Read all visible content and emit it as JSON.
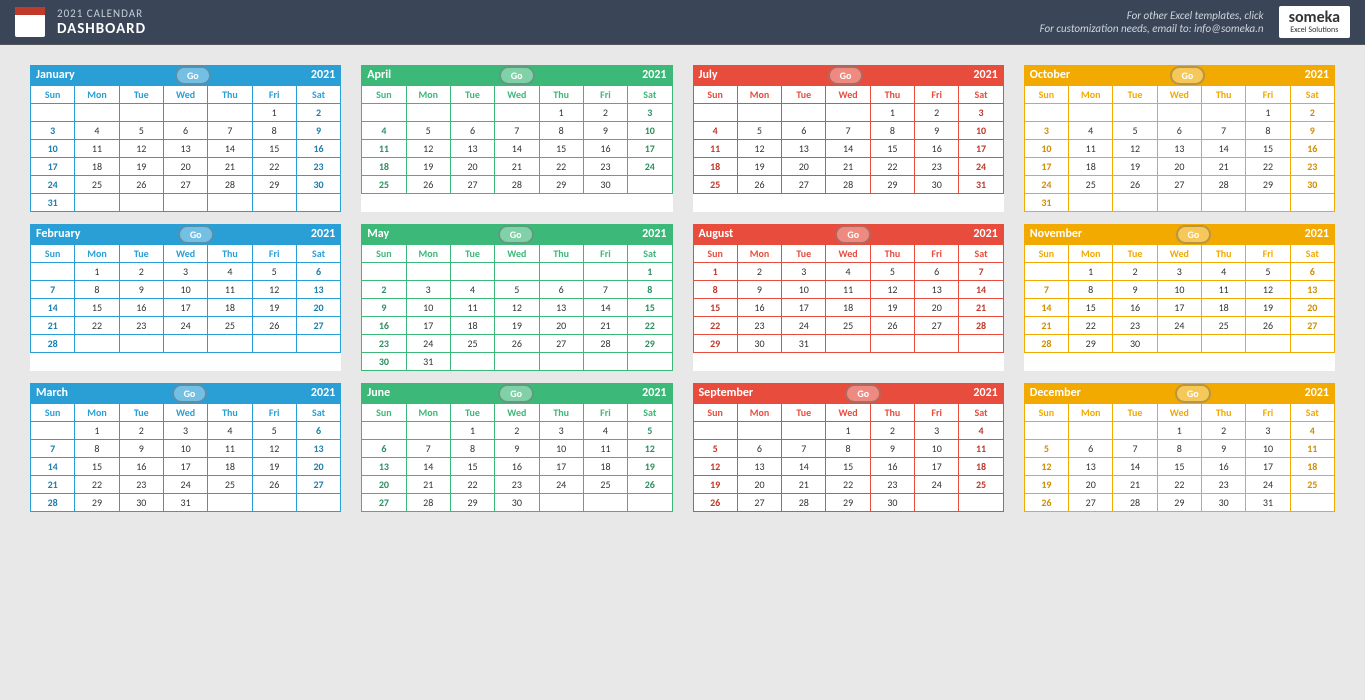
{
  "header": {
    "title": "2021 CALENDAR",
    "subtitle": "DASHBOARD",
    "other": "For other Excel templates, click",
    "custom": "For customization needs, email to: info@someka.n",
    "logo": "someka",
    "logo_sub": "Excel Solutions"
  },
  "go": "Go",
  "days": [
    "Sun",
    "Mon",
    "Tue",
    "Wed",
    "Thu",
    "Fri",
    "Sat"
  ],
  "year": "2021",
  "months": [
    {
      "name": "January",
      "color": "blue",
      "start": 5,
      "end": 31
    },
    {
      "name": "April",
      "color": "green",
      "start": 4,
      "end": 30
    },
    {
      "name": "July",
      "color": "red",
      "start": 4,
      "end": 31
    },
    {
      "name": "October",
      "color": "yellow",
      "start": 5,
      "end": 31
    },
    {
      "name": "February",
      "color": "blue",
      "start": 1,
      "end": 28
    },
    {
      "name": "May",
      "color": "green",
      "start": 6,
      "end": 31
    },
    {
      "name": "August",
      "color": "red",
      "start": 0,
      "end": 31
    },
    {
      "name": "November",
      "color": "yellow",
      "start": 1,
      "end": 30
    },
    {
      "name": "March",
      "color": "blue",
      "start": 1,
      "end": 31
    },
    {
      "name": "June",
      "color": "green",
      "start": 2,
      "end": 30
    },
    {
      "name": "September",
      "color": "red",
      "start": 3,
      "end": 30
    },
    {
      "name": "December",
      "color": "yellow",
      "start": 3,
      "end": 31
    }
  ]
}
